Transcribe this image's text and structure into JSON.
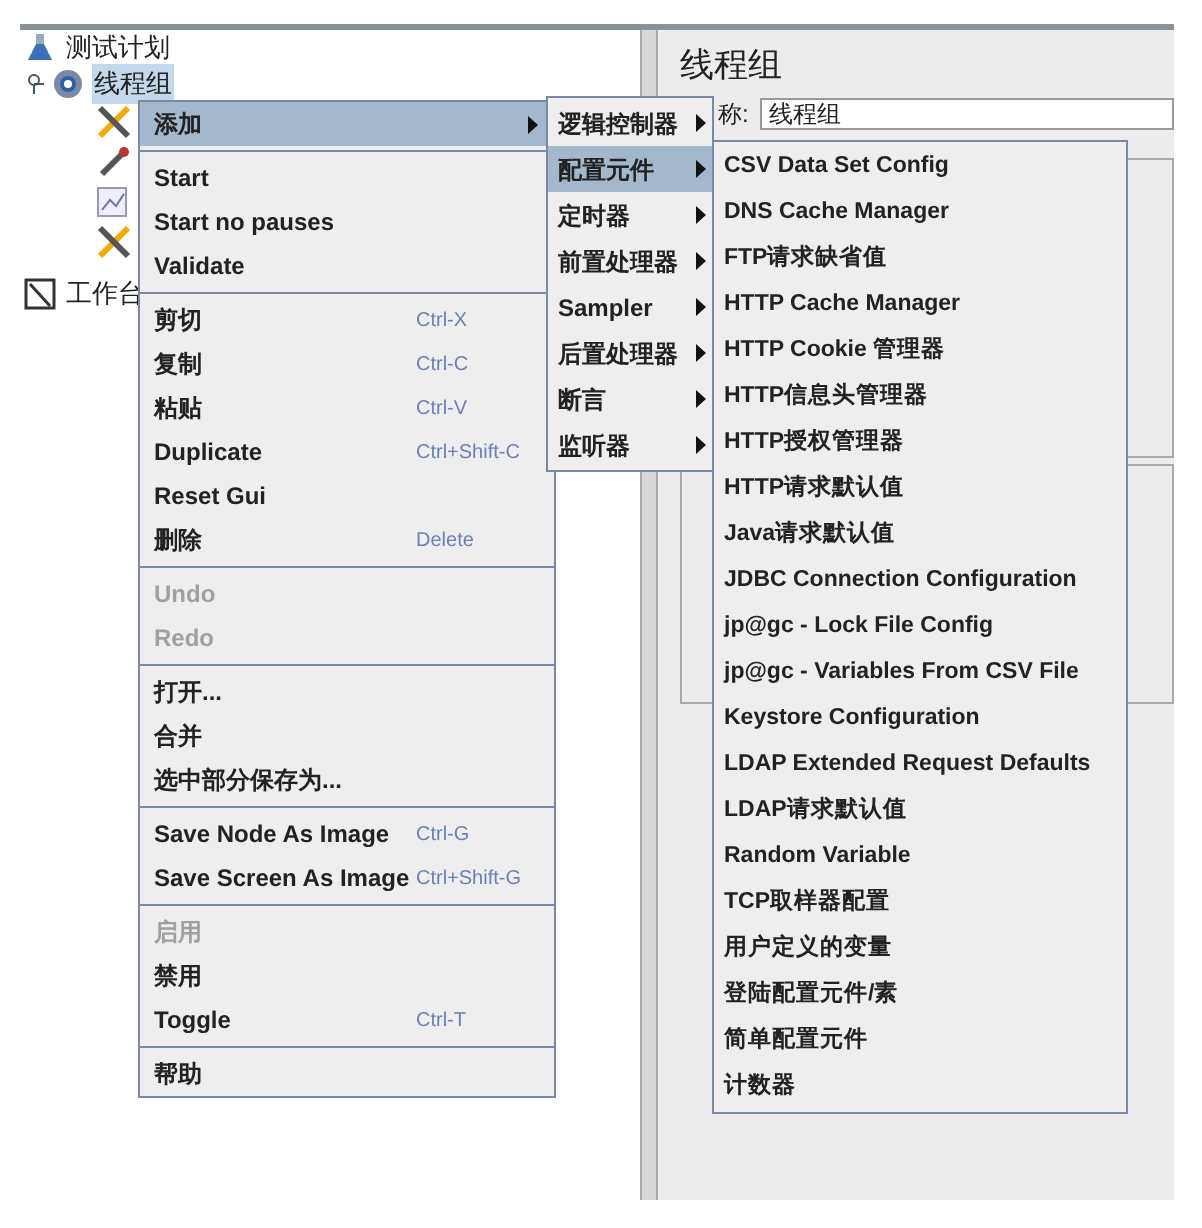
{
  "tree": [
    {
      "label": "测试计划",
      "selected": false,
      "children": [
        {
          "label": "线程组",
          "selected": true,
          "expanded": true
        }
      ]
    },
    {
      "label": "工作台",
      "selected": false
    }
  ],
  "panel": {
    "title": "线程组",
    "name_label": "称:",
    "name_value": "线程组"
  },
  "context_menu": {
    "items": [
      {
        "kind": "item",
        "label": "添加",
        "selected": true,
        "submenu": true,
        "disabled": false
      },
      {
        "kind": "separator"
      },
      {
        "kind": "item",
        "label": "Start",
        "selected": false,
        "submenu": false,
        "disabled": false
      },
      {
        "kind": "item",
        "label": "Start no pauses",
        "selected": false,
        "submenu": false,
        "disabled": false
      },
      {
        "kind": "item",
        "label": "Validate",
        "selected": false,
        "submenu": false,
        "disabled": false
      },
      {
        "kind": "separator"
      },
      {
        "kind": "item",
        "label": "剪切",
        "shortcut": "Ctrl-X",
        "selected": false,
        "submenu": false,
        "disabled": false
      },
      {
        "kind": "item",
        "label": "复制",
        "shortcut": "Ctrl-C",
        "selected": false,
        "submenu": false,
        "disabled": false
      },
      {
        "kind": "item",
        "label": "粘贴",
        "shortcut": "Ctrl-V",
        "selected": false,
        "submenu": false,
        "disabled": false
      },
      {
        "kind": "item",
        "label": "Duplicate",
        "shortcut": "Ctrl+Shift-C",
        "selected": false,
        "submenu": false,
        "disabled": false
      },
      {
        "kind": "item",
        "label": "Reset Gui",
        "selected": false,
        "submenu": false,
        "disabled": false
      },
      {
        "kind": "item",
        "label": "删除",
        "shortcut": "Delete",
        "selected": false,
        "submenu": false,
        "disabled": false
      },
      {
        "kind": "separator"
      },
      {
        "kind": "item",
        "label": "Undo",
        "selected": false,
        "submenu": false,
        "disabled": true
      },
      {
        "kind": "item",
        "label": "Redo",
        "selected": false,
        "submenu": false,
        "disabled": true
      },
      {
        "kind": "separator"
      },
      {
        "kind": "item",
        "label": "打开...",
        "selected": false,
        "submenu": false,
        "disabled": false
      },
      {
        "kind": "item",
        "label": "合并",
        "selected": false,
        "submenu": false,
        "disabled": false
      },
      {
        "kind": "item",
        "label": "选中部分保存为...",
        "selected": false,
        "submenu": false,
        "disabled": false
      },
      {
        "kind": "separator"
      },
      {
        "kind": "item",
        "label": "Save Node As Image",
        "shortcut": "Ctrl-G",
        "selected": false,
        "submenu": false,
        "disabled": false
      },
      {
        "kind": "item",
        "label": "Save Screen As Image",
        "shortcut": "Ctrl+Shift-G",
        "selected": false,
        "submenu": false,
        "disabled": false
      },
      {
        "kind": "separator"
      },
      {
        "kind": "item",
        "label": "启用",
        "selected": false,
        "submenu": false,
        "disabled": true
      },
      {
        "kind": "item",
        "label": "禁用",
        "selected": false,
        "submenu": false,
        "disabled": false
      },
      {
        "kind": "item",
        "label": "Toggle",
        "shortcut": "Ctrl-T",
        "selected": false,
        "submenu": false,
        "disabled": false
      },
      {
        "kind": "separator"
      },
      {
        "kind": "item",
        "label": "帮助",
        "selected": false,
        "submenu": false,
        "disabled": false
      }
    ]
  },
  "add_submenu": {
    "items": [
      {
        "label": "逻辑控制器",
        "selected": false,
        "submenu": true
      },
      {
        "label": "配置元件",
        "selected": true,
        "submenu": true
      },
      {
        "label": "定时器",
        "selected": false,
        "submenu": true
      },
      {
        "label": "前置处理器",
        "selected": false,
        "submenu": true
      },
      {
        "label": "Sampler",
        "selected": false,
        "submenu": true
      },
      {
        "label": "后置处理器",
        "selected": false,
        "submenu": true
      },
      {
        "label": "断言",
        "selected": false,
        "submenu": true
      },
      {
        "label": "监听器",
        "selected": false,
        "submenu": true
      }
    ]
  },
  "config_submenu": {
    "items": [
      {
        "label": "CSV Data Set Config",
        "selected": false
      },
      {
        "label": "DNS Cache Manager",
        "selected": false
      },
      {
        "label": "FTP请求缺省值",
        "selected": false
      },
      {
        "label": "HTTP Cache Manager",
        "selected": false
      },
      {
        "label": "HTTP Cookie 管理器",
        "selected": false
      },
      {
        "label": "HTTP信息头管理器",
        "selected": false
      },
      {
        "label": "HTTP授权管理器",
        "selected": false
      },
      {
        "label": "HTTP请求默认值",
        "selected": false
      },
      {
        "label": "Java请求默认值",
        "selected": false
      },
      {
        "label": "JDBC Connection Configuration",
        "selected": false
      },
      {
        "label": "jp@gc - Lock File Config",
        "selected": false
      },
      {
        "label": "jp@gc - Variables From CSV File",
        "selected": false
      },
      {
        "label": "Keystore Configuration",
        "selected": false
      },
      {
        "label": "LDAP Extended Request Defaults",
        "selected": false
      },
      {
        "label": "LDAP请求默认值",
        "selected": false
      },
      {
        "label": "Random Variable",
        "selected": false
      },
      {
        "label": "TCP取样器配置",
        "selected": false
      },
      {
        "label": "用户定义的变量",
        "selected": false
      },
      {
        "label": "登陆配置元件/素",
        "selected": false
      },
      {
        "label": "简单配置元件",
        "selected": false
      },
      {
        "label": "计数器",
        "selected": false
      }
    ]
  }
}
